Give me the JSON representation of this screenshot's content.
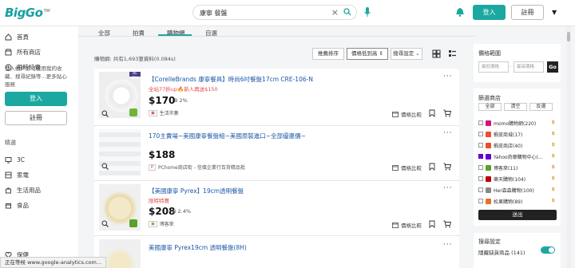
{
  "header": {
    "logo_text": "BigGo",
    "logo_sup": "TW",
    "search_value": "康寧 餐盤",
    "login_label": "登入",
    "register_label": "註冊"
  },
  "sidebar": {
    "items": [
      {
        "label": "首頁",
        "icon": "home-icon"
      },
      {
        "label": "所有商店",
        "icon": "store-icon"
      },
      {
        "label": "限時特賣",
        "icon": "clock-icon"
      }
    ],
    "note": "登入帳戶即可使用我的收藏、搜尋紀錄等...更多貼心服務",
    "login_label": "登入",
    "register_label": "註冊",
    "section_title": "精選",
    "categories": [
      {
        "label": "3C",
        "icon": "monitor-icon"
      },
      {
        "label": "家電",
        "icon": "appliance-icon"
      },
      {
        "label": "生活用品",
        "icon": "bag-icon"
      },
      {
        "label": "食品",
        "icon": "food-icon"
      },
      {
        "label": "保健",
        "icon": "health-icon"
      }
    ]
  },
  "tabs": [
    {
      "label": "全部"
    },
    {
      "label": "拍賣"
    },
    {
      "label": "購物網",
      "active": true
    },
    {
      "label": "自選"
    }
  ],
  "results": {
    "count_text": "購物網: 共有1,693筆資料(0.084s)",
    "sort": [
      {
        "label": "推薦排序"
      },
      {
        "label": "價格低到高 ⇕",
        "active": true
      },
      {
        "label": "搜尋設定 ⌄"
      }
    ]
  },
  "products": [
    {
      "title": "【CorelleBrands 康寧餐具】時尚6吋餐盤17cm CRE-106-N",
      "promo": "全站77折up🔥新人再送$150",
      "price": "$170",
      "pct": "2%",
      "shop": "生活市集",
      "compare_label": "價格比較"
    },
    {
      "title": "170主賣場~美國康寧餐盤組~美國原裝進口~全部優惠價~",
      "promo": "",
      "price": "$188",
      "pct": "",
      "shop": "PChome商店街 - 信傑企業行百貨精品批",
      "compare_label": "價格比較"
    },
    {
      "title": "【美國康寧 Pyrex】19cm透明餐盤",
      "promo": "限時特賣",
      "price": "$208",
      "pct": "2.4%",
      "shop": "博客來",
      "compare_label": "價格比較"
    },
    {
      "title": "美國康寧 Pyrex19cm 透明餐盤(8H)",
      "promo": "",
      "price": "",
      "pct": "",
      "shop": "",
      "compare_label": ""
    }
  ],
  "right_panel": {
    "price_range_title": "價格範圍",
    "min_placeholder": "最低價格",
    "max_placeholder": "最高價格",
    "go_label": "Go",
    "store_title": "篩選商店",
    "all_label": "全部",
    "clear_label": "清空",
    "invert_label": "反選",
    "stores": [
      {
        "name": "momo購物網(220)",
        "color": "#d6127a",
        "checked": false
      },
      {
        "name": "蝦皮商城(17)",
        "color": "#ee4d2d",
        "checked": false
      },
      {
        "name": "蝦皮商店(40)",
        "color": "#ee4d2d",
        "checked": false
      },
      {
        "name": "Yahoo奇摩購物中心(...",
        "color": "#6001d2",
        "checked": true
      },
      {
        "name": "博客來(11)",
        "color": "#5aa02c",
        "checked": false
      },
      {
        "name": "樂天購物(104)",
        "color": "#bf0000",
        "checked": false
      },
      {
        "name": "Her森森購物(100)",
        "color": "#888888",
        "checked": false
      },
      {
        "name": "松果購物(89)",
        "color": "#e4702a",
        "checked": false
      }
    ],
    "out_label": "送出",
    "search_settings_title": "搜尋設定",
    "hide_missing_label": "隱藏缺貨商品",
    "hide_missing_count": "(141)"
  },
  "statusbar": {
    "text": "正在等候 www.google-analytics.com..."
  }
}
